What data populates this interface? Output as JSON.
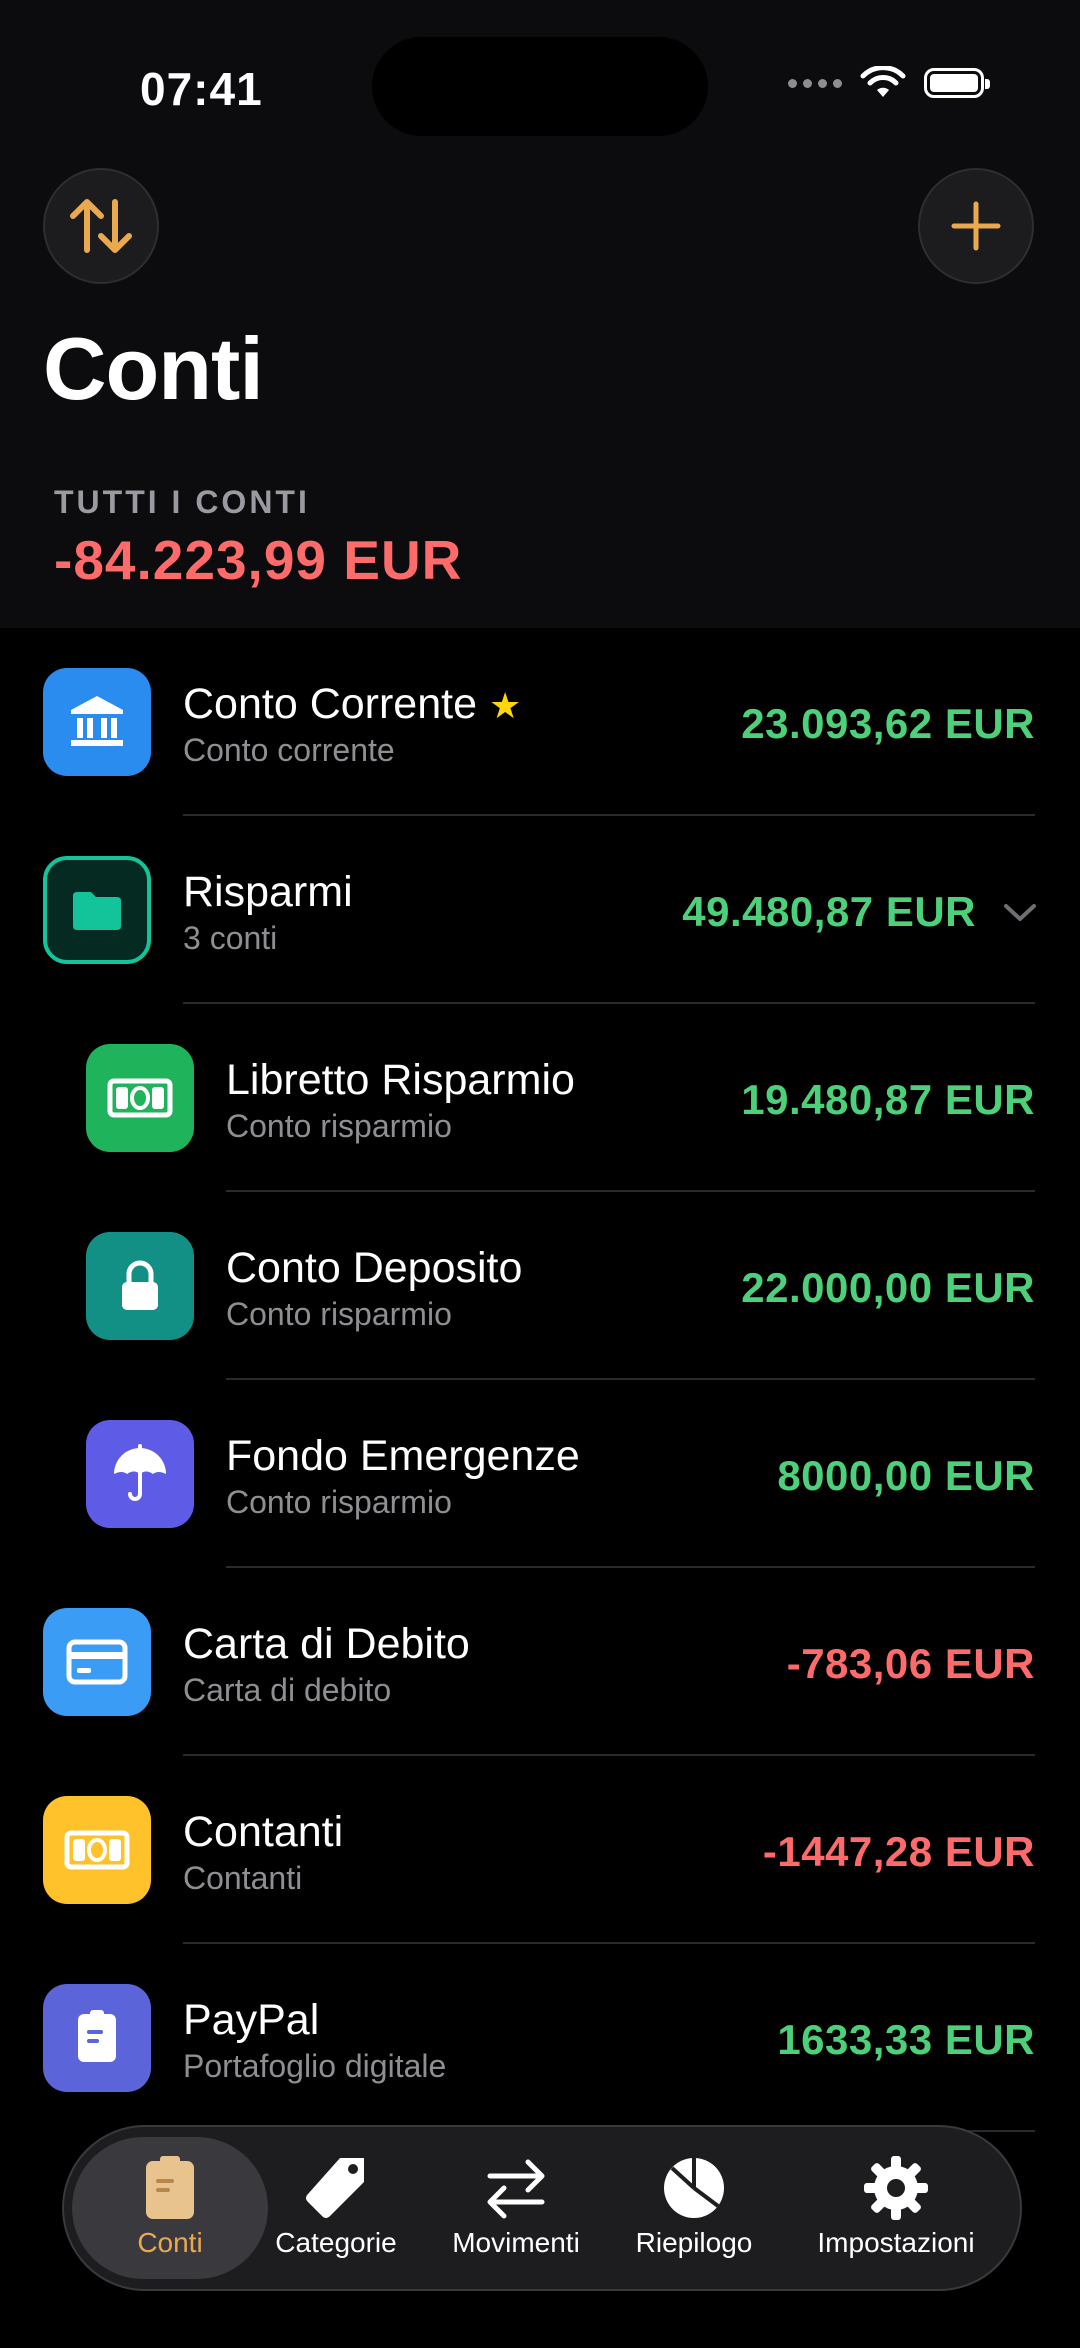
{
  "status_bar": {
    "time": "07:41"
  },
  "header": {
    "title": "Conti",
    "total_label": "TUTTI I CONTI",
    "total_value": "-84.223,99 EUR"
  },
  "accounts": [
    {
      "name": "Conto Corrente",
      "subtitle": "Conto corrente",
      "amount": "23.093,62 EUR",
      "icon": "bank-icon",
      "icon_color": "#2b8cf0",
      "starred": true
    },
    {
      "name": "Risparmi",
      "subtitle": "3 conti",
      "amount": "49.480,87 EUR",
      "icon": "folder-icon",
      "icon_color": "#13c49a",
      "group": true
    },
    {
      "name": "Libretto Risparmio",
      "subtitle": "Conto risparmio",
      "amount": "19.480,87 EUR",
      "icon": "banknote-icon",
      "icon_color": "#1fb35b"
    },
    {
      "name": "Conto Deposito",
      "subtitle": "Conto risparmio",
      "amount": "22.000,00 EUR",
      "icon": "lock-icon",
      "icon_color": "#139085"
    },
    {
      "name": "Fondo Emergenze",
      "subtitle": "Conto risparmio",
      "amount": "8000,00 EUR",
      "icon": "umbrella-icon",
      "icon_color": "#5e5ce6"
    },
    {
      "name": "Carta di Debito",
      "subtitle": "Carta di debito",
      "amount": "-783,06 EUR",
      "icon": "credit-card-icon",
      "icon_color": "#3b9cf5"
    },
    {
      "name": "Contanti",
      "subtitle": "Contanti",
      "amount": "-1447,28 EUR",
      "icon": "cash-icon",
      "icon_color": "#ffc22a"
    },
    {
      "name": "PayPal",
      "subtitle": "Portafoglio digitale",
      "amount": "1633,33 EUR",
      "icon": "wallet-icon",
      "icon_color": "#5b65d9"
    }
  ],
  "tabs": [
    {
      "label": "Conti",
      "icon": "account-book-icon",
      "active": true
    },
    {
      "label": "Categorie",
      "icon": "tag-icon"
    },
    {
      "label": "Movimenti",
      "icon": "transfer-arrows-icon"
    },
    {
      "label": "Riepilogo",
      "icon": "pie-chart-icon"
    },
    {
      "label": "Impostazioni",
      "icon": "gear-icon"
    }
  ],
  "colors": {
    "accent": "#e9a94e",
    "positive": "#4cd17a",
    "negative": "#ff6b6b"
  }
}
